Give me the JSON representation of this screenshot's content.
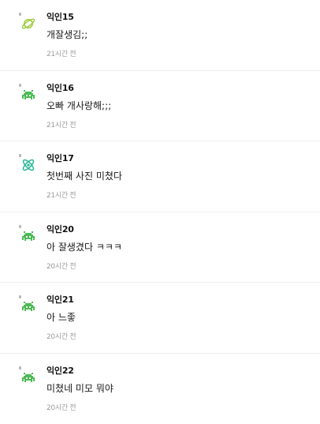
{
  "comments": [
    {
      "author": "익인15",
      "text": "개잘생김;;",
      "time": "21시간 전",
      "avatar_icon": "planet-icon",
      "avatar_color": "#9ccc3d"
    },
    {
      "author": "익인16",
      "text": "오빠 개사랑해;;;",
      "time": "21시간 전",
      "avatar_icon": "space-invader-icon",
      "avatar_color": "#4cbb55"
    },
    {
      "author": "익인17",
      "text": "첫번째 사진 미쳤다",
      "time": "21시간 전",
      "avatar_icon": "atom-icon",
      "avatar_color": "#2bb59a"
    },
    {
      "author": "익인20",
      "text": "아 잘생겼다 ㅋㅋㅋ",
      "time": "20시간 전",
      "avatar_icon": "space-invader-icon",
      "avatar_color": "#4cbb55"
    },
    {
      "author": "익인21",
      "text": "아 느좋",
      "time": "20시간 전",
      "avatar_icon": "space-invader-icon",
      "avatar_color": "#4cbb55"
    },
    {
      "author": "익인22",
      "text": "미쳤네 미모 뭐야",
      "time": "20시간 전",
      "avatar_icon": "space-invader-icon",
      "avatar_color": "#4cbb55"
    }
  ]
}
